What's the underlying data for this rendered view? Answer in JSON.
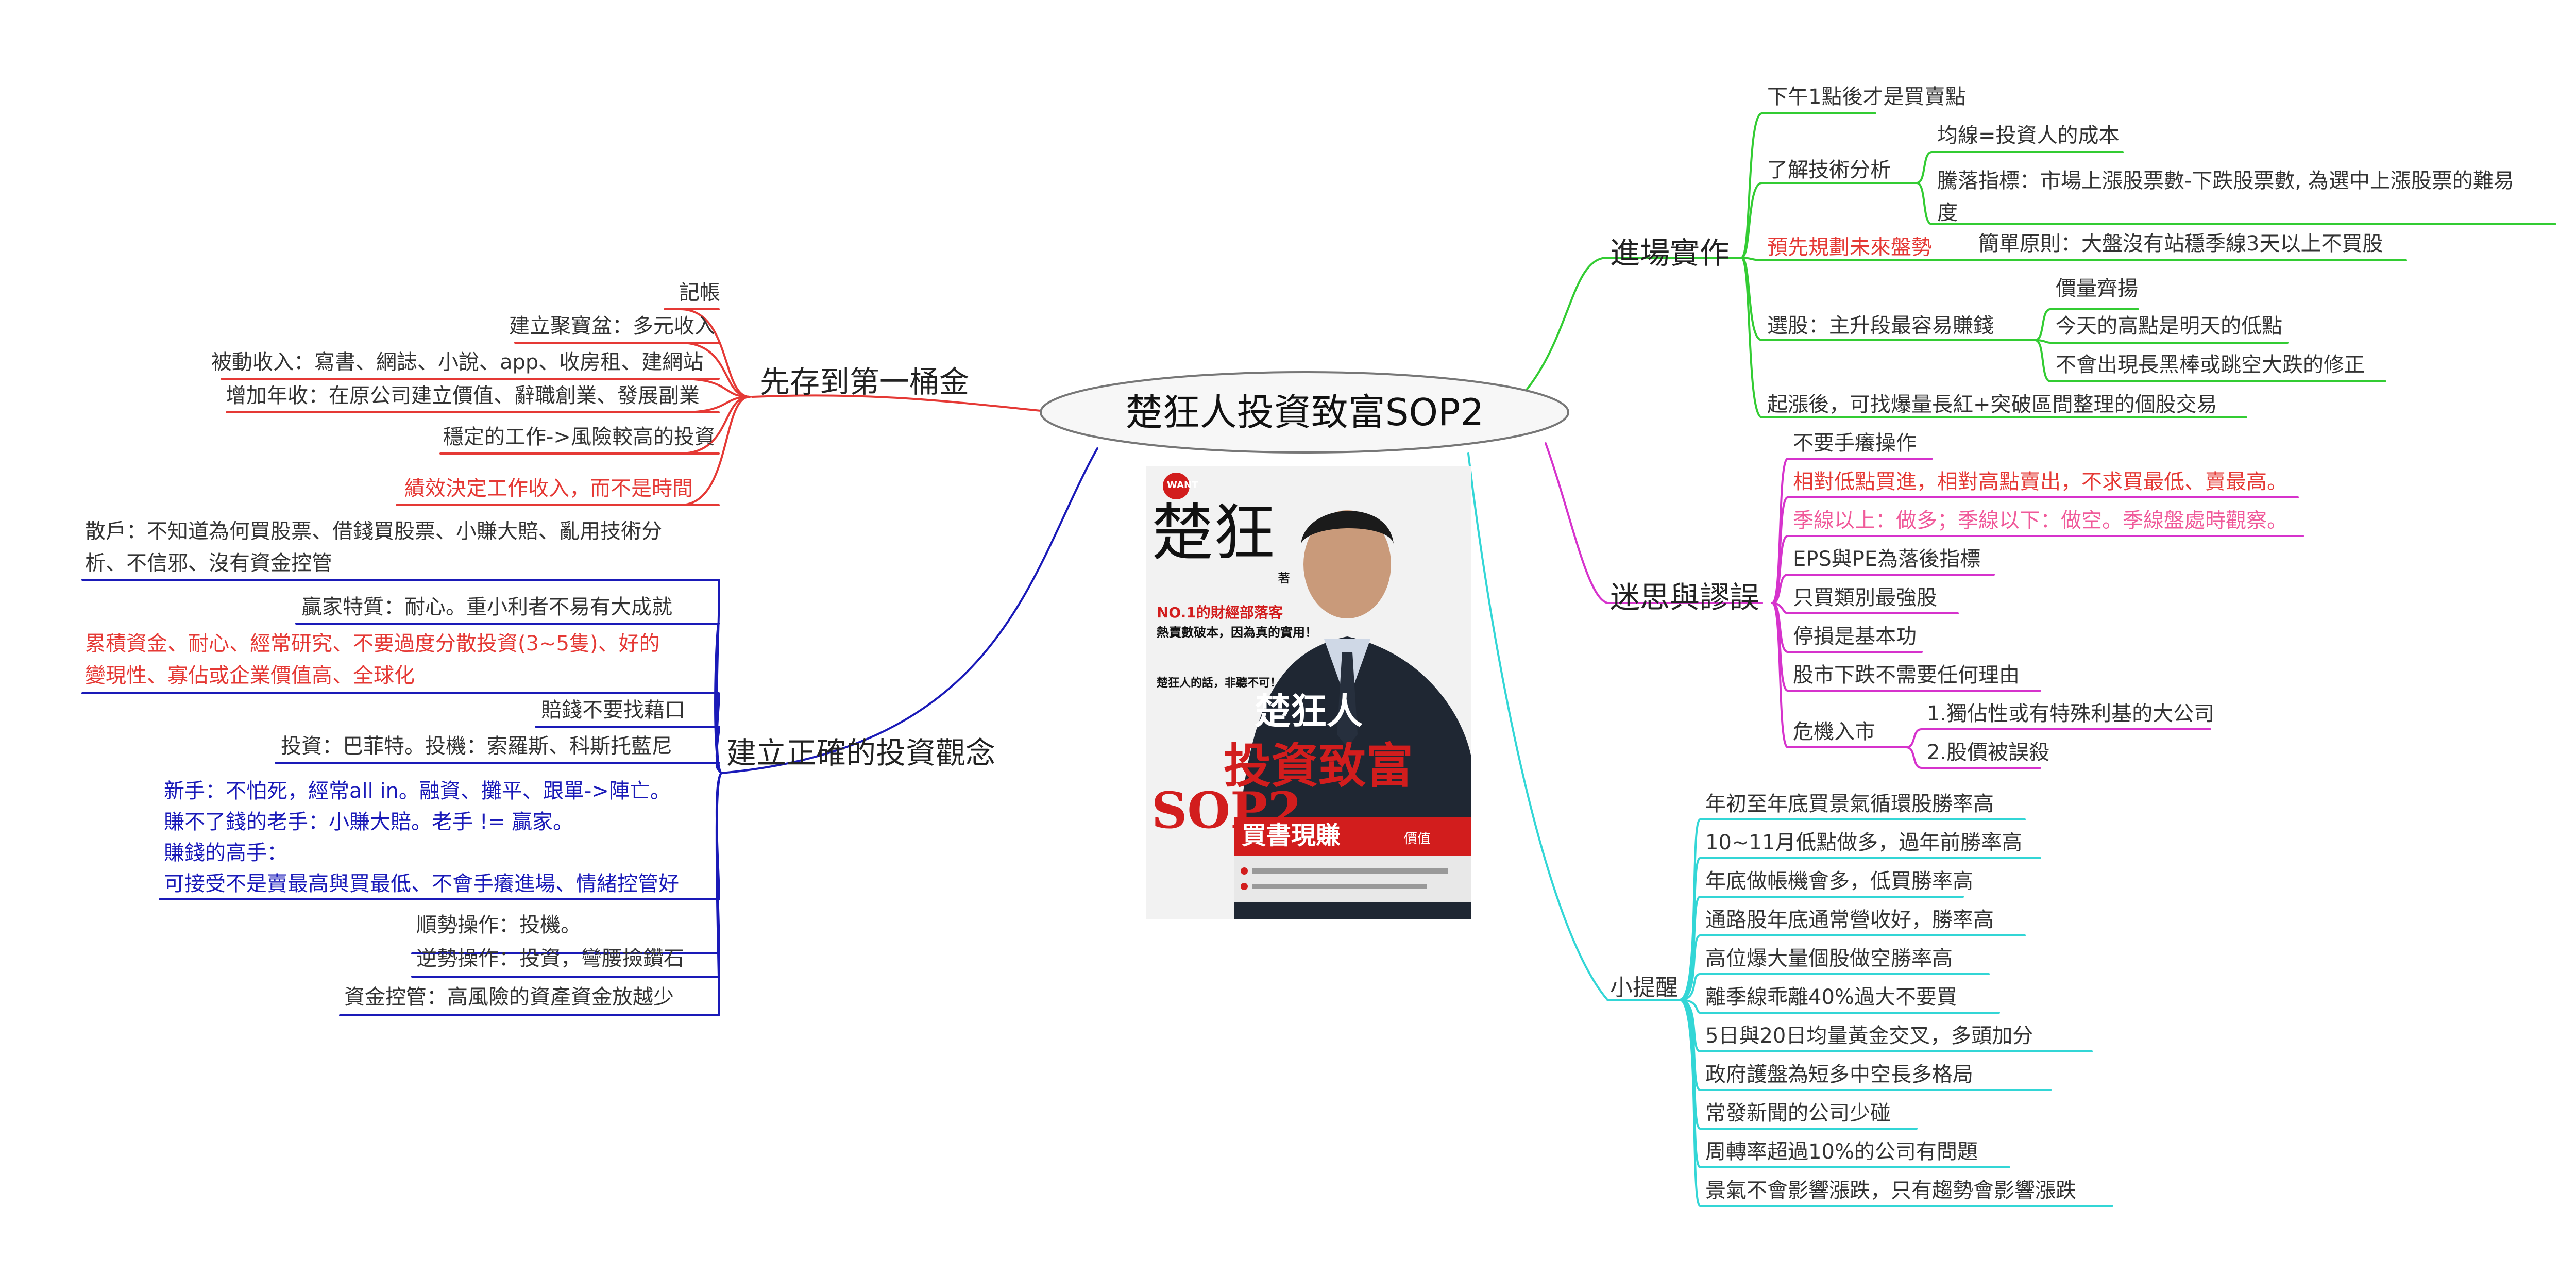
{
  "center": {
    "title": "楚狂人投資致富SOP2"
  },
  "book": {
    "logo_text": "WANT",
    "stamp_chars": "楚狂",
    "stamp_sig": "著",
    "title_main": "楚狂人",
    "title_big": "投資致富",
    "title_sop": "SOP2",
    "banner": "買書現賺",
    "banner_small": "價值",
    "tag_line1": "NO.1的財經部落客",
    "tag_line2": "熱賣數破本，因為真的實用！",
    "quote": "楚狂人的話，非聽不可！"
  },
  "colors": {
    "red": "#e53935",
    "blue": "#1a1ab8",
    "green": "#33cc33",
    "magenta": "#d633cc",
    "cyan": "#33d6d6",
    "pink": "#f05a9a"
  },
  "branches": {
    "save": {
      "label": "先存到第一桶金",
      "items": [
        "記帳",
        "建立聚寶盆：多元收入",
        "被動收入：寫書、網誌、小說、app、收房租、建網站",
        "增加年收：在原公司建立價值、辭職創業、發展副業",
        "穩定的工作->風險較高的投資",
        "績效決定工作收入，而不是時間"
      ]
    },
    "concept": {
      "label": "建立正確的投資觀念",
      "items": [
        "散戶：不知道為何買股票、借錢買股票、小賺大賠、亂用技術分析、不信邪、沒有資金控管",
        "贏家特質：耐心。重小利者不易有大成就",
        "累積資金、耐心、經常研究、不要過度分散投資(3~5隻)、好的變現性、寡佔或企業價值高、全球化",
        "賠錢不要找藉口",
        "投資：巴菲特。投機：索羅斯、科斯托藍尼",
        "新手：不怕死，經常all in。融資、攤平、跟單->陣亡。",
        "賺不了錢的老手：小賺大賠。老手 != 贏家。",
        "賺錢的高手：",
        "可接受不是賣最高與買最低、不會手癢進場、情緒控管好",
        "順勢操作：投機。",
        "逆勢操作：投資，彎腰撿鑽石",
        "資金控管：高風險的資產資金放越少"
      ]
    },
    "practice": {
      "label": "進場實作",
      "buy_time": "下午1點後才是買賣點",
      "tech": "了解技術分析",
      "tech_items": [
        "均線=投資人的成本",
        "騰落指標：市場上漲股票數-下跌股票數, 為選中上漲股票的難易度"
      ],
      "plan": "預先規劃未來盤勢",
      "plan_item": "簡單原則：大盤沒有站穩季線3天以上不買股",
      "pick": "選股：主升段最容易賺錢",
      "pick_items": [
        "價量齊揚",
        "今天的高點是明天的低點",
        "不會出現長黑棒或跳空大跌的修正"
      ],
      "rise": "起漲後，可找爆量長紅+突破區間整理的個股交易"
    },
    "myth": {
      "label": "迷思與謬誤",
      "items": [
        "不要手癢操作",
        "相對低點買進，相對高點賣出，不求買最低、賣最高。",
        "季線以上：做多；季線以下：做空。季線盤處時觀察。",
        "EPS與PE為落後指標",
        "只買類別最強股",
        "停損是基本功",
        "股市下跌不需要任何理由"
      ],
      "crisis": "危機入市",
      "crisis_items": [
        "1.獨佔性或有特殊利基的大公司",
        "2.股價被誤殺"
      ]
    },
    "tips": {
      "label": "小提醒",
      "items": [
        "年初至年底買景氣循環股勝率高",
        "10~11月低點做多，過年前勝率高",
        "年底做帳機會多，低買勝率高",
        "通路股年底通常營收好，勝率高",
        "高位爆大量個股做空勝率高",
        "離季線乖離40%過大不要買",
        "5日與20日均量黃金交叉，多頭加分",
        "政府護盤為短多中空長多格局",
        "常發新聞的公司少碰",
        "周轉率超過10%的公司有問題",
        "景氣不會影響漲跌，只有趨勢會影響漲跌"
      ]
    }
  }
}
